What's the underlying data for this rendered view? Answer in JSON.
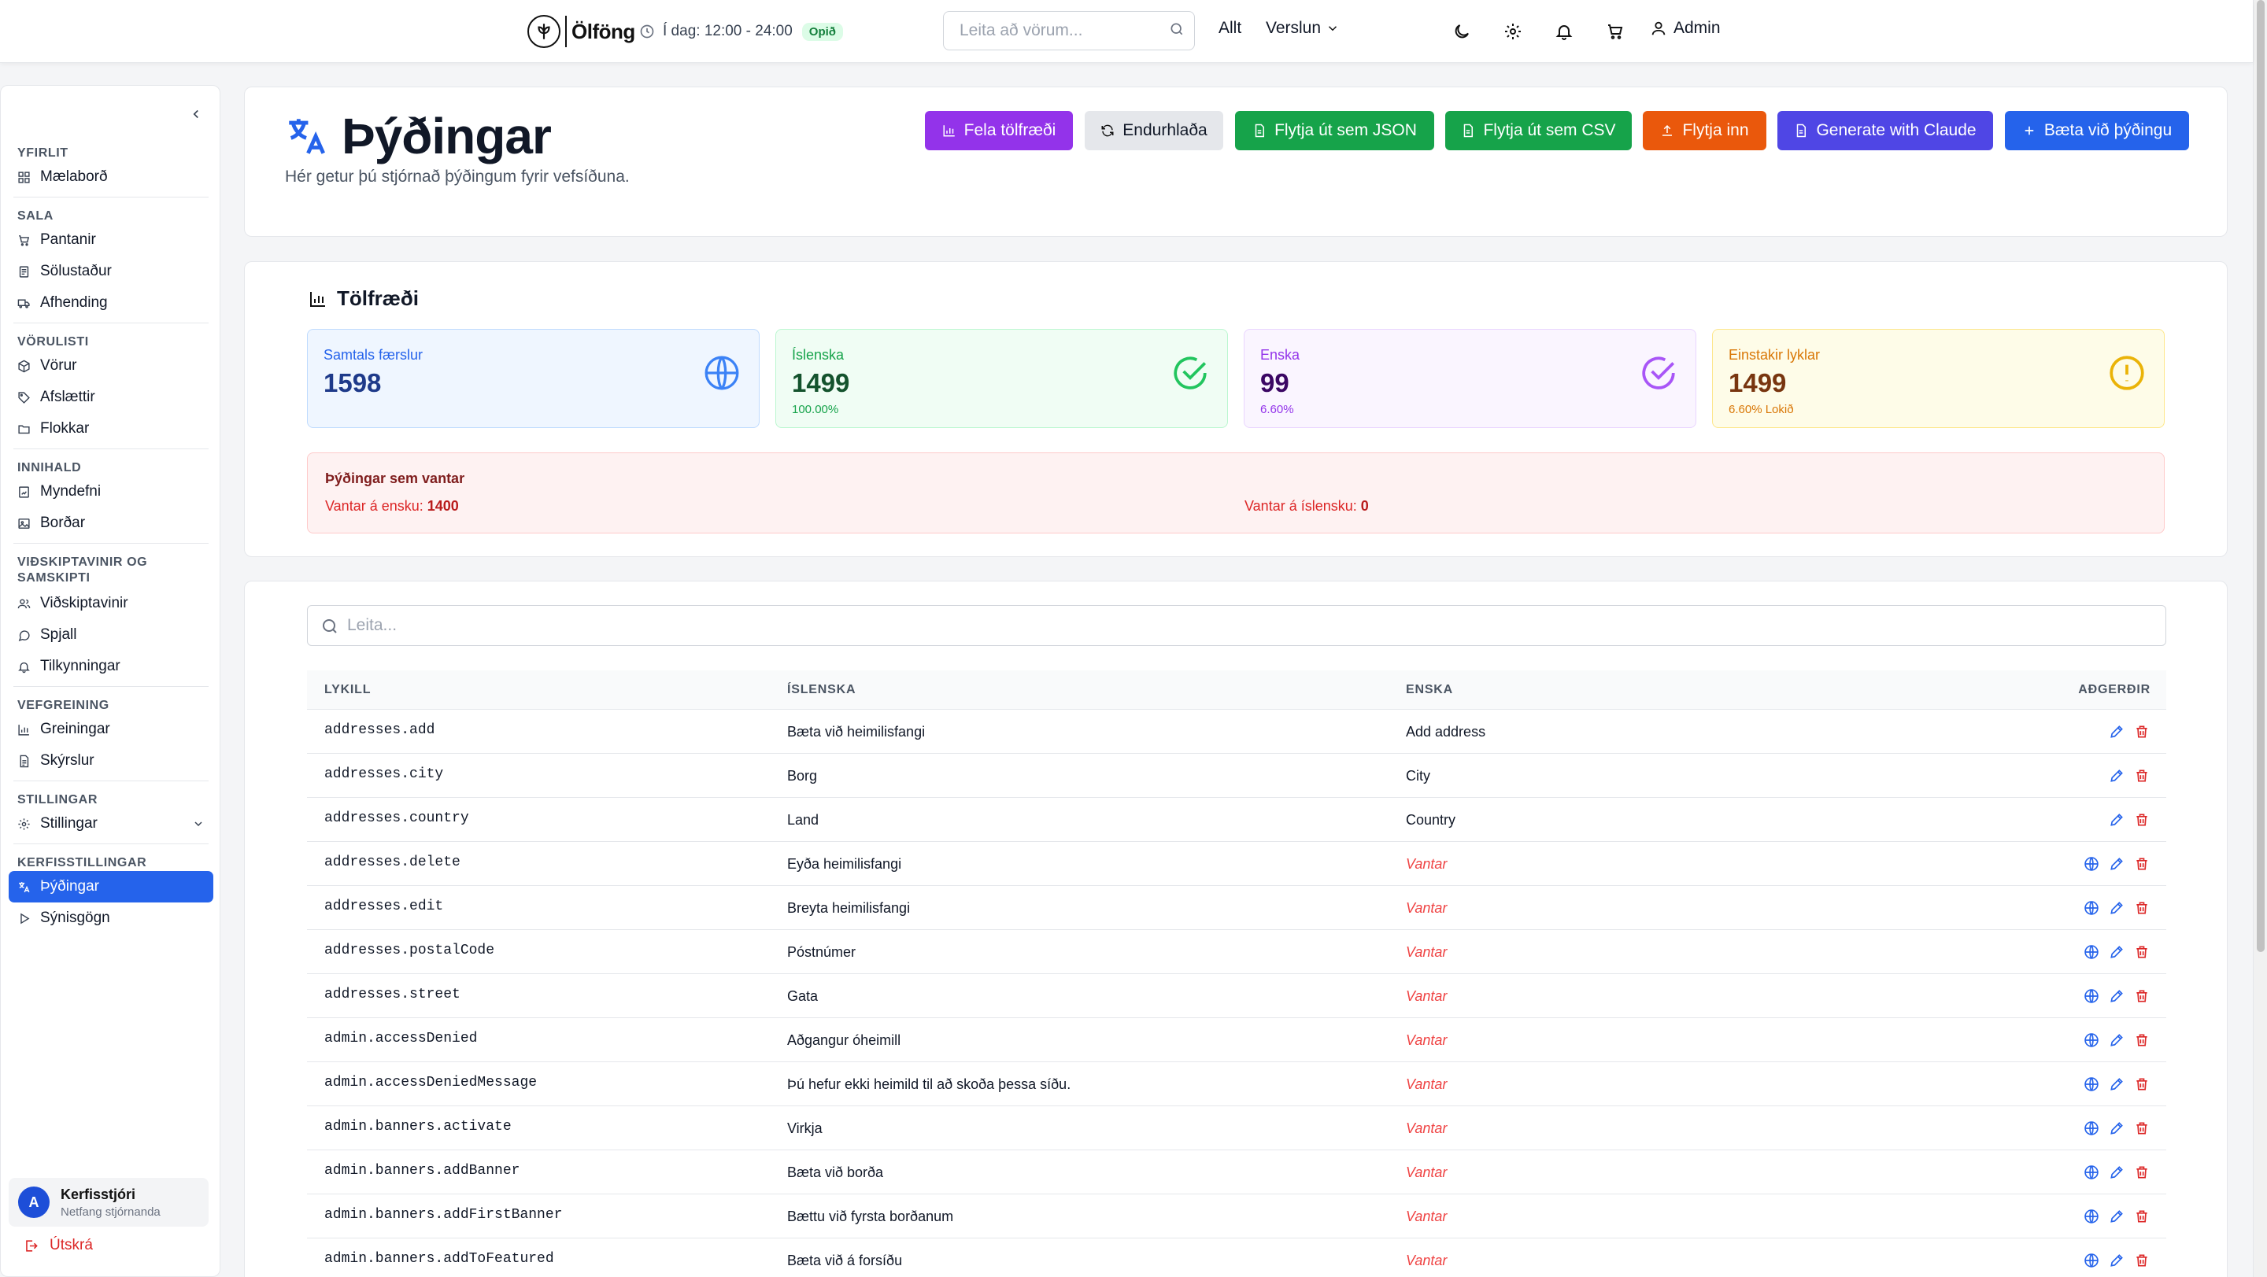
{
  "header": {
    "brand": "Ölföng",
    "hours": "Í dag: 12:00 - 24:00",
    "open_badge": "Opið",
    "search_placeholder": "Leita að vörum...",
    "nav_all": "Allt",
    "nav_store": "Verslun",
    "admin_label": "Admin"
  },
  "sidebar": {
    "groups": [
      {
        "title": "YFIRLIT",
        "items": [
          {
            "label": "Mælaborð",
            "icon": "dashboard-icon"
          }
        ]
      },
      {
        "title": "SALA",
        "items": [
          {
            "label": "Pantanir",
            "icon": "cart-icon"
          },
          {
            "label": "Sölustaður",
            "icon": "receipt-icon"
          },
          {
            "label": "Afhending",
            "icon": "truck-icon"
          }
        ]
      },
      {
        "title": "VÖRULISTI",
        "items": [
          {
            "label": "Vörur",
            "icon": "package-icon"
          },
          {
            "label": "Afslættir",
            "icon": "tag-icon"
          },
          {
            "label": "Flokkar",
            "icon": "folder-icon"
          }
        ]
      },
      {
        "title": "INNIHALD",
        "items": [
          {
            "label": "Myndefni",
            "icon": "media-icon"
          },
          {
            "label": "Borðar",
            "icon": "image-icon"
          }
        ]
      },
      {
        "title": "VIÐSKIPTAVINIR OG SAMSKIPTI",
        "items": [
          {
            "label": "Viðskiptavinir",
            "icon": "users-icon"
          },
          {
            "label": "Spjall",
            "icon": "chat-icon"
          },
          {
            "label": "Tilkynningar",
            "icon": "bell-icon"
          }
        ]
      },
      {
        "title": "VEFGREINING",
        "items": [
          {
            "label": "Greiningar",
            "icon": "bar-chart-icon"
          },
          {
            "label": "Skýrslur",
            "icon": "report-icon"
          }
        ]
      },
      {
        "title": "STILLINGAR",
        "items": [
          {
            "label": "Stillingar",
            "icon": "gear-icon"
          }
        ]
      },
      {
        "title": "KERFISSTILLINGAR",
        "items": [
          {
            "label": "Þýðingar",
            "icon": "translate-icon"
          },
          {
            "label": "Sýnisgögn",
            "icon": "play-icon"
          }
        ]
      }
    ],
    "user": {
      "initial": "A",
      "name": "Kerfisstjóri",
      "email": "Netfang stjórnanda"
    },
    "logout": "Útskrá"
  },
  "page": {
    "title": "Þýðingar",
    "description": "Hér getur þú stjórnað þýðingum fyrir vefsíðuna.",
    "buttons": {
      "hide_stats": "Fela tölfræði",
      "reload": "Endurhlaða",
      "export_json": "Flytja út sem JSON",
      "export_csv": "Flytja út sem CSV",
      "import": "Flytja inn",
      "generate": "Generate with Claude",
      "add": "Bæta við þýðingu"
    }
  },
  "stats": {
    "title": "Tölfræði",
    "cards": [
      {
        "label": "Samtals færslur",
        "value": "1598",
        "sub": ""
      },
      {
        "label": "Íslenska",
        "value": "1499",
        "sub": "100.00%"
      },
      {
        "label": "Enska",
        "value": "99",
        "sub": "6.60%"
      },
      {
        "label": "Einstakir lyklar",
        "value": "1499",
        "sub": "6.60% Lokið"
      }
    ],
    "missing": {
      "title": "Þýðingar sem vantar",
      "en_label": "Vantar á ensku:",
      "en_value": "1400",
      "is_label": "Vantar á íslensku:",
      "is_value": "0"
    },
    "colors": {
      "blue": "#2563eb",
      "green": "#16a34a",
      "purple": "#9333ea",
      "amber": "#d97706"
    }
  },
  "table": {
    "search_placeholder": "Leita...",
    "headers": {
      "key": "LYKILL",
      "is": "ÍSLENSKA",
      "en": "ENSKA",
      "actions": "AÐGERÐIR"
    },
    "rows": [
      {
        "key": "addresses.add",
        "is": "Bæta við heimilisfangi",
        "en": "Add address",
        "missing": false
      },
      {
        "key": "addresses.city",
        "is": "Borg",
        "en": "City",
        "missing": false
      },
      {
        "key": "addresses.country",
        "is": "Land",
        "en": "Country",
        "missing": false
      },
      {
        "key": "addresses.delete",
        "is": "Eyða heimilisfangi",
        "en": "Vantar",
        "missing": true
      },
      {
        "key": "addresses.edit",
        "is": "Breyta heimilisfangi",
        "en": "Vantar",
        "missing": true
      },
      {
        "key": "addresses.postalCode",
        "is": "Póstnúmer",
        "en": "Vantar",
        "missing": true
      },
      {
        "key": "addresses.street",
        "is": "Gata",
        "en": "Vantar",
        "missing": true
      },
      {
        "key": "admin.accessDenied",
        "is": "Aðgangur óheimill",
        "en": "Vantar",
        "missing": true
      },
      {
        "key": "admin.accessDeniedMessage",
        "is": "Þú hefur ekki heimild til að skoða þessa síðu.",
        "en": "Vantar",
        "missing": true
      },
      {
        "key": "admin.banners.activate",
        "is": "Virkja",
        "en": "Vantar",
        "missing": true
      },
      {
        "key": "admin.banners.addBanner",
        "is": "Bæta við borða",
        "en": "Vantar",
        "missing": true
      },
      {
        "key": "admin.banners.addFirstBanner",
        "is": "Bættu við fyrsta borðanum",
        "en": "Vantar",
        "missing": true
      },
      {
        "key": "admin.banners.addToFeatured",
        "is": "Bæta við á forsíðu",
        "en": "Vantar",
        "missing": true
      }
    ]
  }
}
